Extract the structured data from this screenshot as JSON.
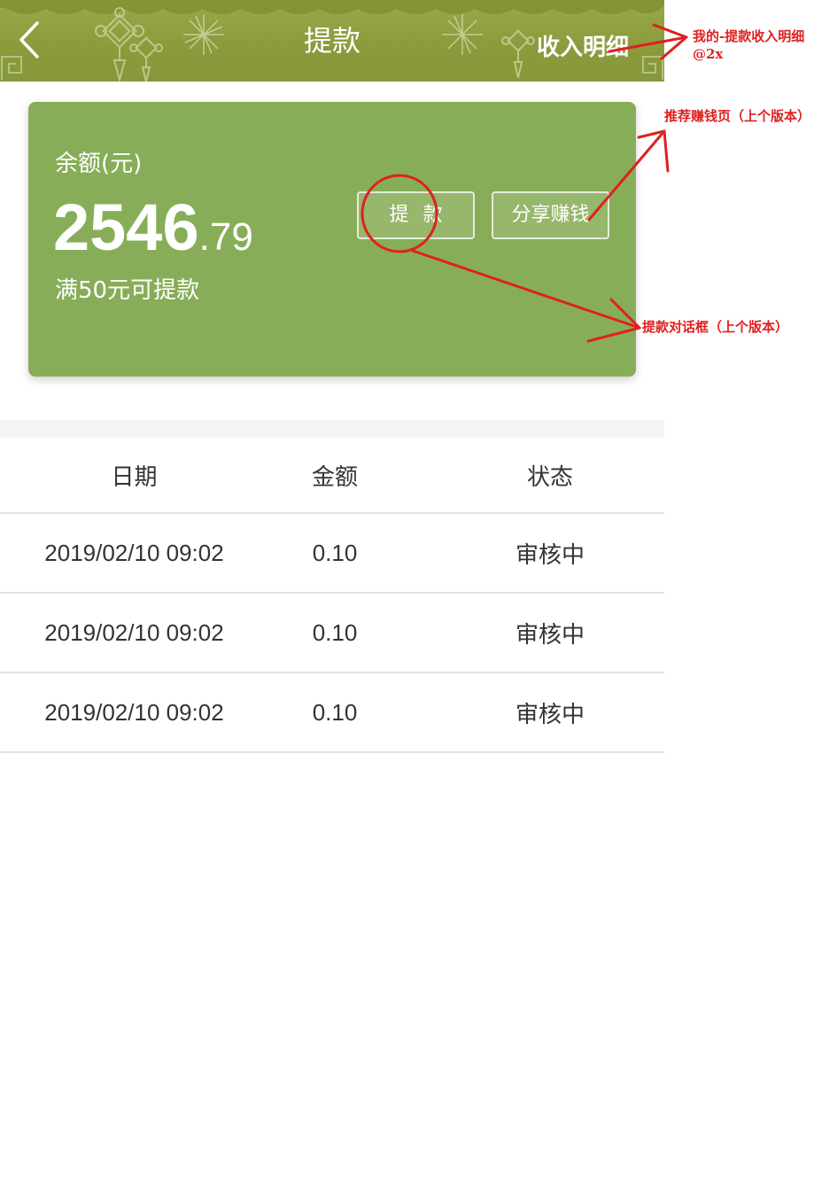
{
  "header": {
    "title": "提款",
    "right_link": "收入明细",
    "back_icon": "chevron-left-icon",
    "background_color": "#8fa040"
  },
  "card": {
    "label": "余额(元)",
    "amount_int": "2546",
    "amount_dec": ".79",
    "hint": "满50元可提款",
    "withdraw_button": "提款",
    "share_button": "分享赚钱",
    "background_color": "#88ad58"
  },
  "table": {
    "headers": [
      "日期",
      "金额",
      "状态"
    ],
    "rows": [
      {
        "date": "2019/02/10 09:02",
        "amount": "0.10",
        "status": "审核中"
      },
      {
        "date": "2019/02/10 09:02",
        "amount": "0.10",
        "status": "审核中"
      },
      {
        "date": "2019/02/10 09:02",
        "amount": "0.10",
        "status": "审核中"
      }
    ]
  },
  "annotations": {
    "note_income_detail": "我的-提款收入明细@2x",
    "note_recommend": "推荐赚钱页（上个版本）",
    "note_withdraw_dialog": "提款对话框（上个版本）",
    "color": "#e02020"
  }
}
